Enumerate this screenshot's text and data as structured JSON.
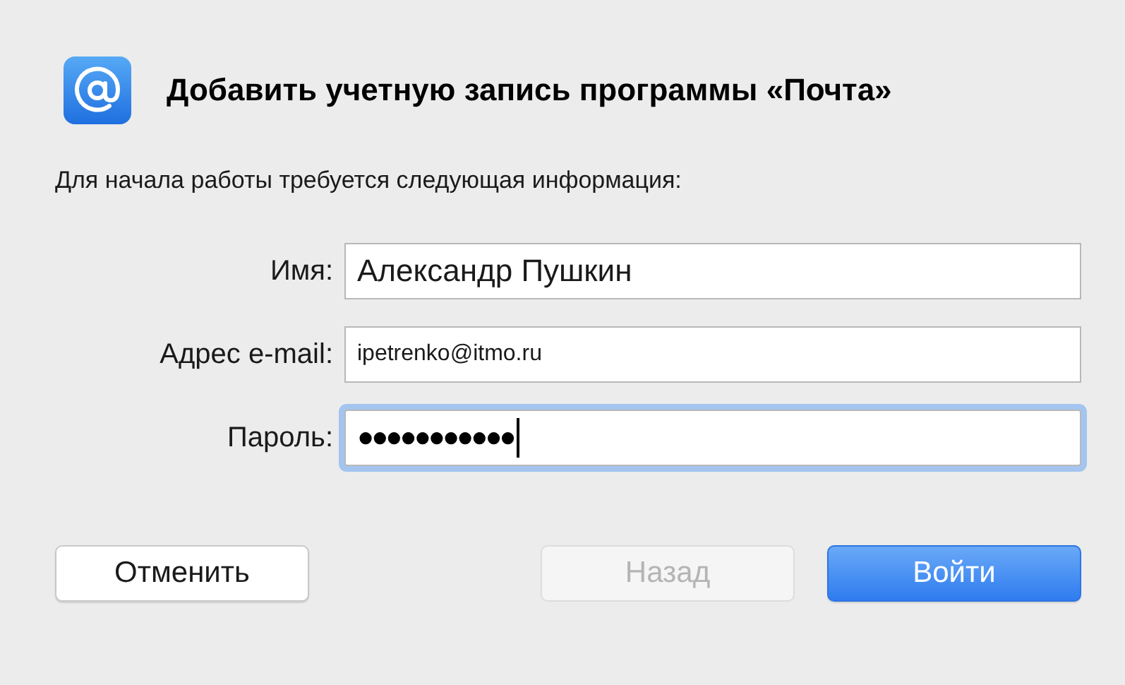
{
  "dialog": {
    "title": "Добавить учетную запись программы «Почта»",
    "subtitle": "Для начала работы требуется следующая информация:"
  },
  "fields": [
    {
      "label": "Имя:",
      "value": "Александр Пушкин",
      "kind": "large",
      "focused": false
    },
    {
      "label": "Адрес e-mail:",
      "value": "ipetrenko@itmo.ru",
      "kind": "small",
      "focused": false
    },
    {
      "label": "Пароль:",
      "value": "●●●●●●●●●●●",
      "kind": "secret",
      "focused": true
    }
  ],
  "buttons": [
    {
      "label": "Отменить",
      "kind": "normal",
      "disabled": false
    },
    {
      "label": "Назад",
      "kind": "normal",
      "disabled": true
    },
    {
      "label": "Войти",
      "kind": "default",
      "disabled": false
    }
  ]
}
